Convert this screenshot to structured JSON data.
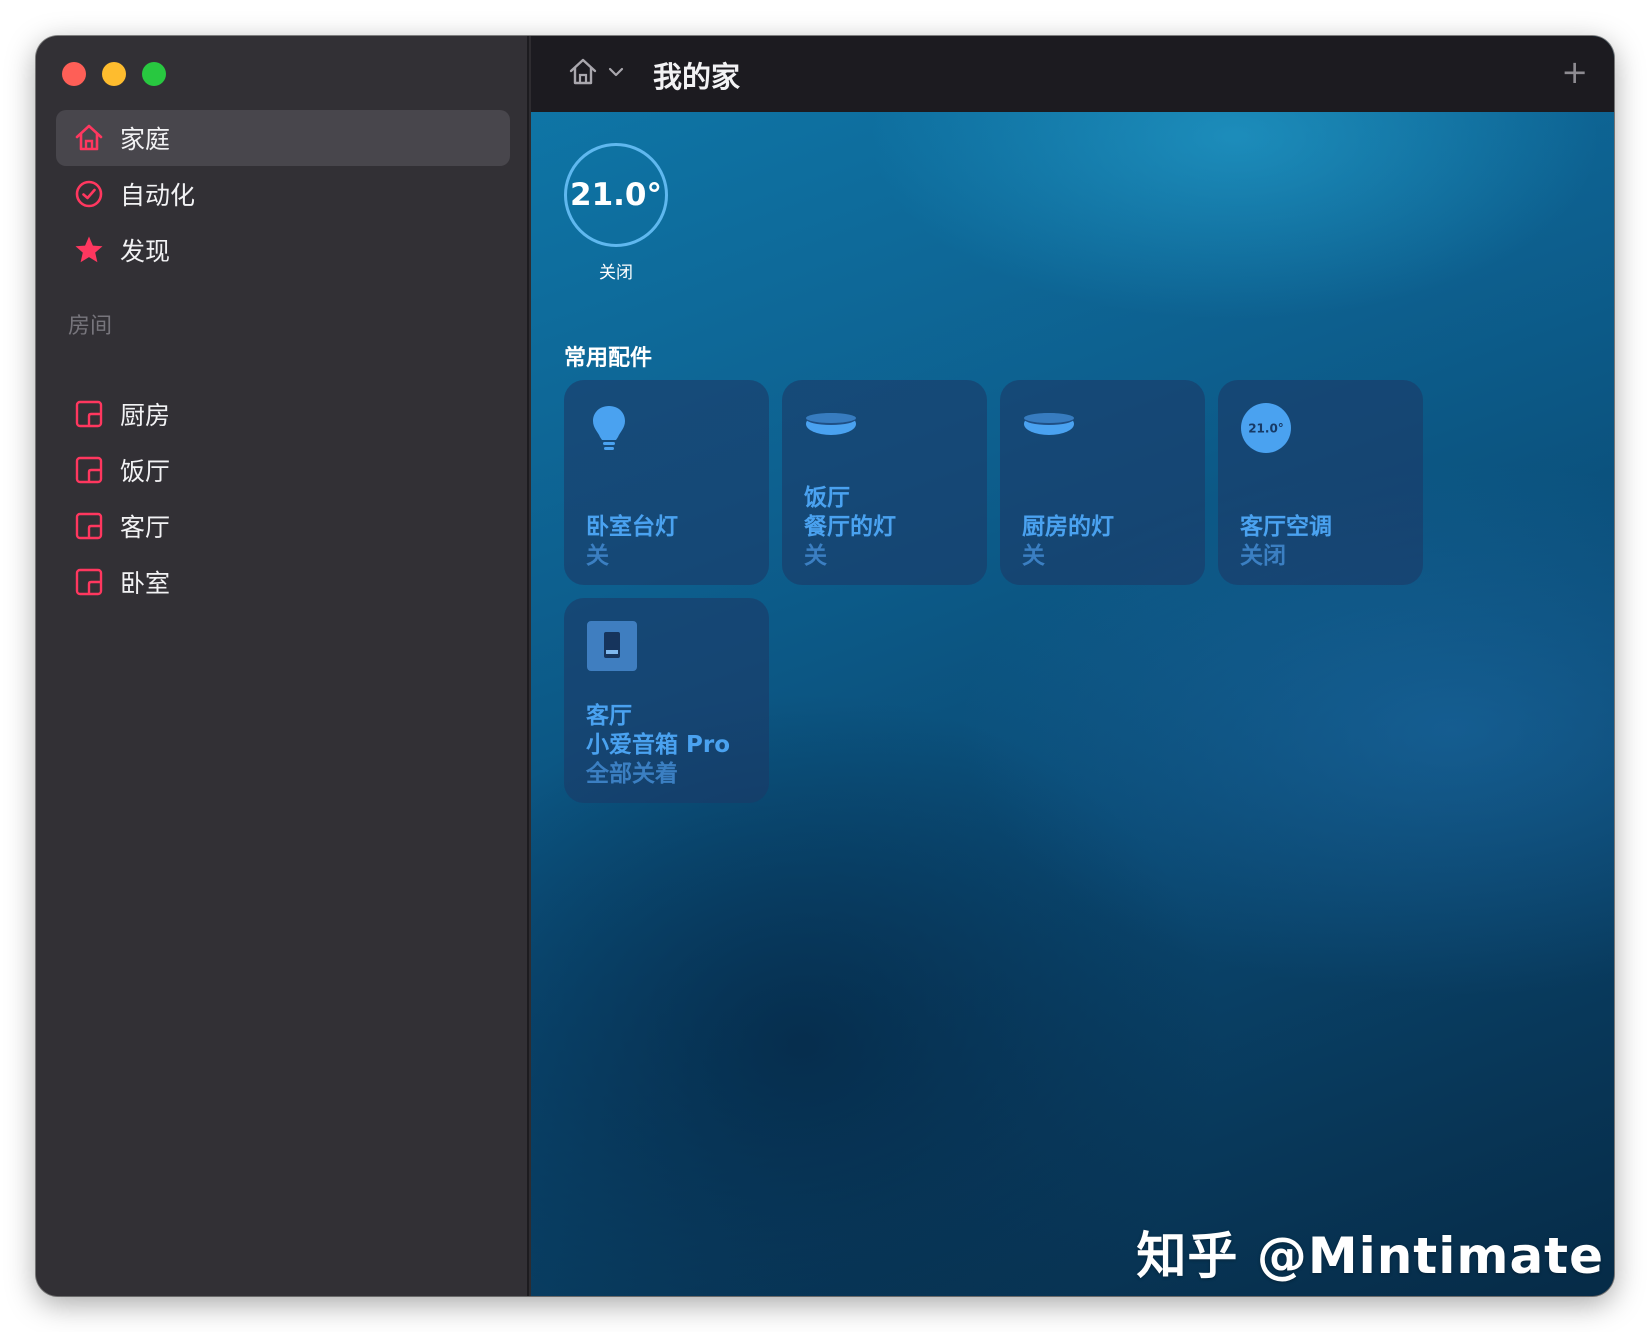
{
  "window": {
    "controls": [
      "close",
      "minimize",
      "zoom"
    ]
  },
  "sidebar": {
    "nav": [
      {
        "label": "家庭",
        "icon": "home-icon",
        "active": true
      },
      {
        "label": "自动化",
        "icon": "clock-icon",
        "active": false
      },
      {
        "label": "发现",
        "icon": "star-icon",
        "active": false
      }
    ],
    "rooms_label": "房间",
    "rooms": [
      {
        "label": "厨房",
        "icon": "room-icon"
      },
      {
        "label": "饭厅",
        "icon": "room-icon"
      },
      {
        "label": "客厅",
        "icon": "room-icon"
      },
      {
        "label": "卧室",
        "icon": "room-icon"
      }
    ]
  },
  "toolbar": {
    "title": "我的家",
    "add_label": "+"
  },
  "climate": {
    "temperature": "21.0°",
    "status": "关闭"
  },
  "favorites": {
    "title": "常用配件",
    "tiles": [
      {
        "icon": "bulb-icon",
        "room": "",
        "name": "卧室台灯",
        "status": "关"
      },
      {
        "icon": "ceiling-light-icon",
        "room": "饭厅",
        "name": "餐厅的灯",
        "status": "关"
      },
      {
        "icon": "ceiling-light-icon",
        "room": "",
        "name": "厨房的灯",
        "status": "关"
      },
      {
        "icon": "thermostat-icon",
        "icon_text": "21.0°",
        "room": "",
        "name": "客厅空调",
        "status": "关闭"
      },
      {
        "icon": "speaker-icon",
        "room": "客厅",
        "name": "小爱音箱 Pro",
        "status": "全部关着"
      }
    ]
  },
  "watermark": "知乎 @Mintimate",
  "colors": {
    "accent": "#ff375f",
    "tile_text": "#4aa2f0",
    "sidebar_bg": "#323035",
    "toolbar_bg": "#1c1b20"
  }
}
